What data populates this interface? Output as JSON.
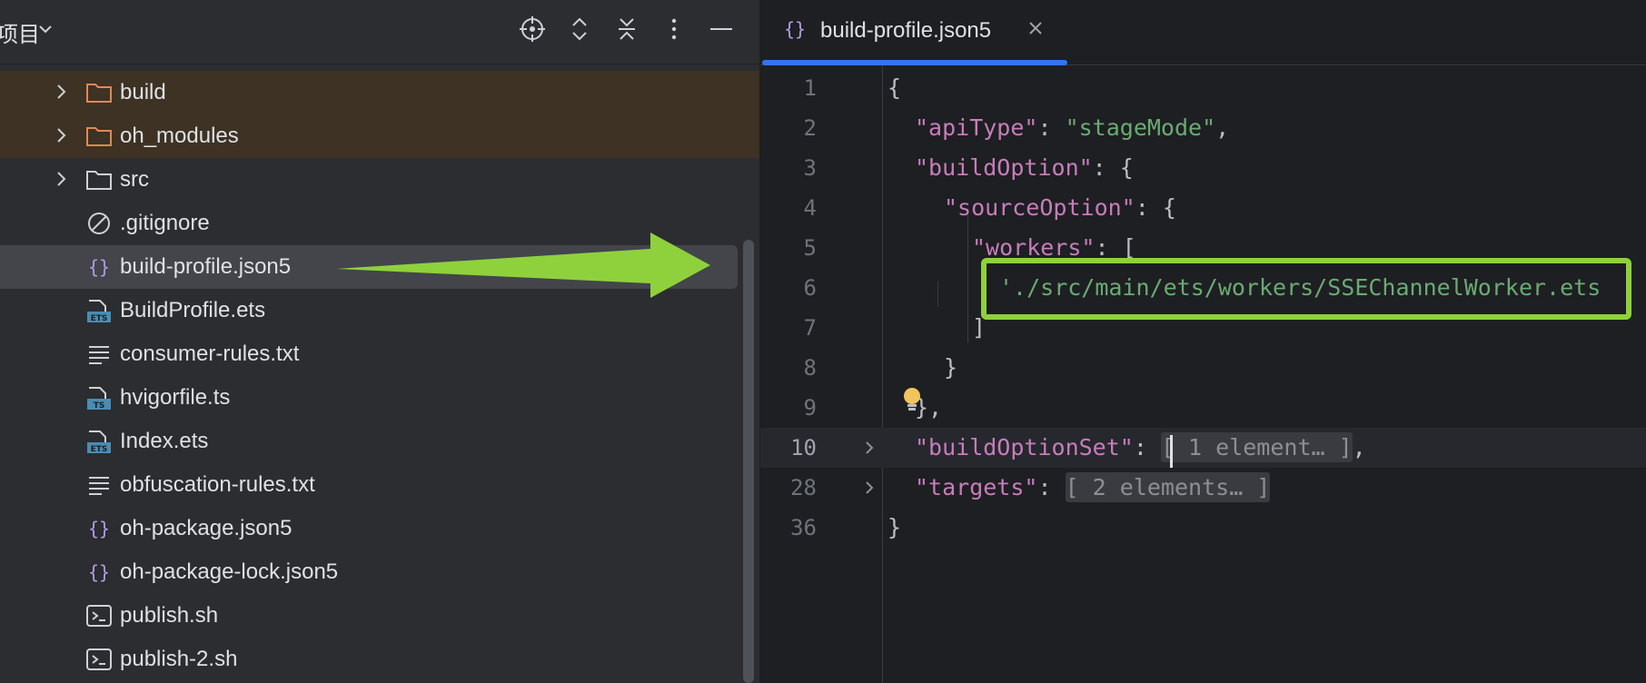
{
  "project_panel": {
    "title": "项目",
    "items": [
      {
        "name": "build",
        "type": "folder",
        "expandable": true,
        "excluded": true
      },
      {
        "name": "oh_modules",
        "type": "folder",
        "expandable": true,
        "excluded": true
      },
      {
        "name": "src",
        "type": "folder",
        "expandable": true,
        "excluded": false
      },
      {
        "name": ".gitignore",
        "type": "ignore-file"
      },
      {
        "name": "build-profile.json5",
        "type": "json5-file",
        "selected": true
      },
      {
        "name": "BuildProfile.ets",
        "type": "ets-file",
        "badge": "ETS"
      },
      {
        "name": "consumer-rules.txt",
        "type": "text-file"
      },
      {
        "name": "hvigorfile.ts",
        "type": "ts-file",
        "badge": "TS"
      },
      {
        "name": "Index.ets",
        "type": "ets-file",
        "badge": "ETS"
      },
      {
        "name": "obfuscation-rules.txt",
        "type": "text-file"
      },
      {
        "name": "oh-package.json5",
        "type": "json5-file"
      },
      {
        "name": "oh-package-lock.json5",
        "type": "json5-file"
      },
      {
        "name": "publish.sh",
        "type": "shell-file"
      },
      {
        "name": "publish-2.sh",
        "type": "shell-file"
      }
    ],
    "toolbar_icons": [
      "locate-icon",
      "expand-all-icon",
      "collapse-all-icon",
      "more-options-icon",
      "minimize-icon"
    ]
  },
  "editor": {
    "tab": {
      "label": "build-profile.json5"
    },
    "lines": [
      {
        "num": "1"
      },
      {
        "num": "2"
      },
      {
        "num": "3"
      },
      {
        "num": "4"
      },
      {
        "num": "5"
      },
      {
        "num": "6"
      },
      {
        "num": "7"
      },
      {
        "num": "8"
      },
      {
        "num": "9"
      },
      {
        "num": "10"
      },
      {
        "num": "28"
      },
      {
        "num": "36"
      }
    ],
    "code": {
      "open_brace": "{",
      "api_type_key": "\"apiType\"",
      "api_type_value": "\"stageMode\"",
      "build_option_key": "\"buildOption\"",
      "source_option_key": "\"sourceOption\"",
      "workers_key": "\"workers\"",
      "worker_path": "'./src/main/ets/workers/SSEChannelWorker.ets",
      "close_bracket": "]",
      "close_brace_inner": "}",
      "close_brace_option": "},",
      "build_option_set_key": "\"buildOptionSet\"",
      "build_option_set_folded": "[ 1 element… ]",
      "targets_key": "\"targets\"",
      "targets_folded": "[ 2 elements… ]",
      "close_brace": "}"
    }
  },
  "colors": {
    "highlight": "#8fd13c",
    "arrow": "#8fd13c",
    "tab_accent": "#3574f0"
  }
}
